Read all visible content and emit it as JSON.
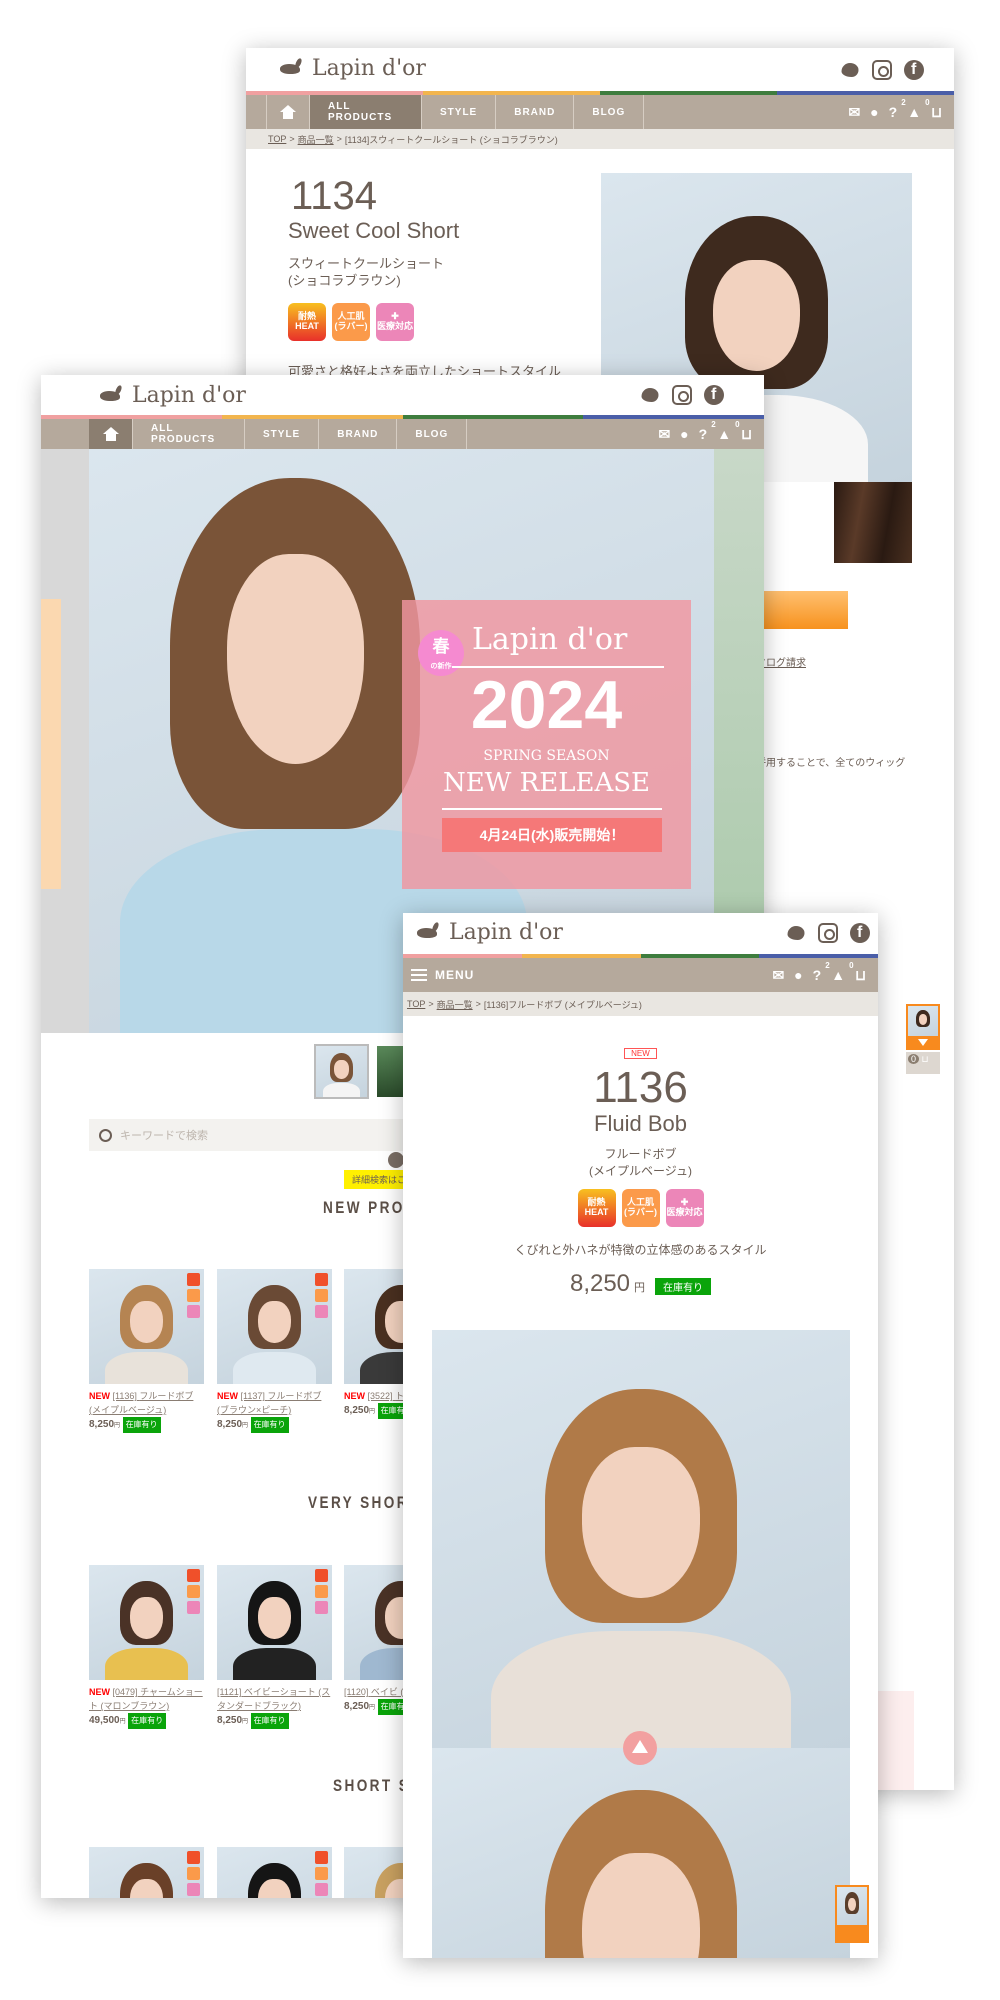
{
  "brand": {
    "logo_text": "Lapin d'or"
  },
  "colors": {
    "nav": "#b5a99c",
    "nav_active": "#8b7e70",
    "stripe": [
      "#f0a0a0",
      "#f2b54e",
      "#3e7d3e",
      "#4a5ea8"
    ],
    "stock": "#0aa40a",
    "new": "#ff0000"
  },
  "social": [
    "twitter-icon",
    "instagram-icon",
    "facebook-icon"
  ],
  "nav": {
    "items": [
      "ALL PRODUCTS",
      "STYLE",
      "BRAND",
      "BLOG"
    ],
    "menu": "MENU",
    "notif_count": "2",
    "cart_count": "0"
  },
  "back_page": {
    "breadcrumb": [
      "TOP",
      "商品一覧",
      "[1134]スウィートクールショート (ショコラブラウン)"
    ],
    "code": "1134",
    "name_en": "Sweet Cool Short",
    "name_jp": "スウィートクールショート",
    "color_jp": "(ショコラブラウン)",
    "badges": [
      {
        "l1": "耐熱",
        "l2": "HEAT"
      },
      {
        "l1": "人工肌",
        "l2": "(ラバー)"
      },
      {
        "l1": "✚",
        "l2": "医療対応"
      }
    ],
    "description": "可愛さと格好よさを両立したショートスタイル",
    "catalog_link": "カタログ請求",
    "body_text": "を併用することで、全てのウィッグ"
  },
  "mid_page": {
    "banner": {
      "sakura": "春",
      "sakura_sub": "の新作",
      "brand": "Lapin d'or",
      "year": "2024",
      "season": "SPRING SEASON",
      "release": "NEW RELEASE",
      "date": "4月24日(水)販売開始！"
    },
    "search_placeholder": "キーワードで検索",
    "tooltip": "詳細検索はこ",
    "sections": [
      {
        "title": "NEW PRODUCTS",
        "items": [
          {
            "new": "NEW",
            "code": "[1136]",
            "name": "フルードボブ(メイプルベージュ)",
            "price": "8,250",
            "unit": "円",
            "stock": "在庫有り",
            "hair": "#b58452",
            "body": "#e8e2da"
          },
          {
            "new": "NEW",
            "code": "[1137]",
            "name": "フルードボブ(ブラウン×ピーチ)",
            "price": "8,250",
            "unit": "円",
            "stock": "在庫有り",
            "hair": "#6a4a35",
            "body": "#dfe9f0"
          },
          {
            "new": "NEW",
            "code": "[3522]",
            "name": "ト (ショコラブ",
            "price": "8,250",
            "unit": "円",
            "stock": "在庫有り",
            "hair": "#4a3020",
            "body": "#3a3a3a"
          }
        ]
      },
      {
        "title": "VERY SHORT",
        "items": [
          {
            "new": "NEW",
            "code": "[0479]",
            "name": "チャームショート (マロンブラウン)",
            "price": "49,500",
            "unit": "円",
            "stock": "在庫有り",
            "hair": "#4a3226",
            "body": "#e8c050"
          },
          {
            "new": "",
            "code": "[1121]",
            "name": "ベイビーショート (スタンダードブラック)",
            "price": "8,250",
            "unit": "円",
            "stock": "在庫有り",
            "hair": "#151515",
            "body": "#222"
          },
          {
            "new": "",
            "code": "[1120]",
            "name": "ベイビ (ショコラブラ",
            "price": "8,250",
            "unit": "円",
            "stock": "在庫有り",
            "hair": "#4a3226",
            "body": "#9fb8d0"
          }
        ]
      },
      {
        "title": "SHORT S",
        "items": [
          {
            "hair": "#6a4028"
          },
          {
            "hair": "#151515"
          },
          {
            "hair": "#c8a060"
          }
        ]
      }
    ]
  },
  "front_page": {
    "breadcrumb": [
      "TOP",
      "商品一覧",
      "[1136]フルードボブ (メイプルベージュ)"
    ],
    "new_tag": "NEW",
    "code": "1136",
    "name_en": "Fluid Bob",
    "name_jp": "フルードボブ",
    "color_jp": "(メイプルベージュ)",
    "badges": [
      {
        "l1": "耐熱",
        "l2": "HEAT"
      },
      {
        "l1": "人工肌",
        "l2": "(ラバー)"
      },
      {
        "l1": "✚",
        "l2": "医療対応"
      }
    ],
    "description": "くびれと外ハネが特徴の立体感のあるスタイル",
    "price": "8,250",
    "unit": "円",
    "stock": "在庫有り",
    "cart_count": "0"
  }
}
